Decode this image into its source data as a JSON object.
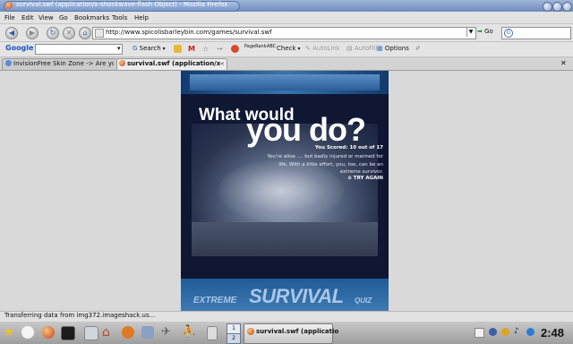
{
  "window": {
    "title": "survival.swf (application/x-shockwave-flash Object) - Mozilla Firefox"
  },
  "menu": {
    "items": [
      "File",
      "Edit",
      "View",
      "Go",
      "Bookmarks",
      "Tools",
      "Help"
    ]
  },
  "navigation": {
    "url": "http://www.spicolisbarleybin.com/games/survival.swf",
    "go_label": "Go",
    "search_value": ""
  },
  "google_toolbar": {
    "logo": "Google",
    "search_value": "",
    "search_label": "Search",
    "pagerank_label": "PageRank",
    "check_label": "Check",
    "autolink_label": "AutoLink",
    "autofill_label": "AutoFill",
    "options_label": "Options"
  },
  "tabs": [
    {
      "label": "InvisionFree Skin Zone -> Are you...",
      "active": false
    },
    {
      "label": "survival.swf (application/x-sh...",
      "active": true
    }
  ],
  "flash": {
    "headline_line1": "What would",
    "headline_line2": "you do?",
    "score_title": "You Scored: 10 out of 17",
    "score_body": "You're alive .... but badly injured or maimed for life. With a little effort, you, too, can be an extreme survivor.",
    "try_again": "TRY AGAIN",
    "logo_left": "EXTREME",
    "logo_center": "SURVIVAL",
    "logo_right": "QUIZ"
  },
  "status": {
    "text": "Transferring data from img372.imageshack.us..."
  },
  "taskbar": {
    "pager": [
      "1",
      "2"
    ],
    "task_label": "survival.swf (applicatio",
    "clock": "2:48"
  },
  "colors": {
    "titlebar": "#7d99c6",
    "flash_background": "#0f1733",
    "flash_band": "#3a73ad"
  }
}
